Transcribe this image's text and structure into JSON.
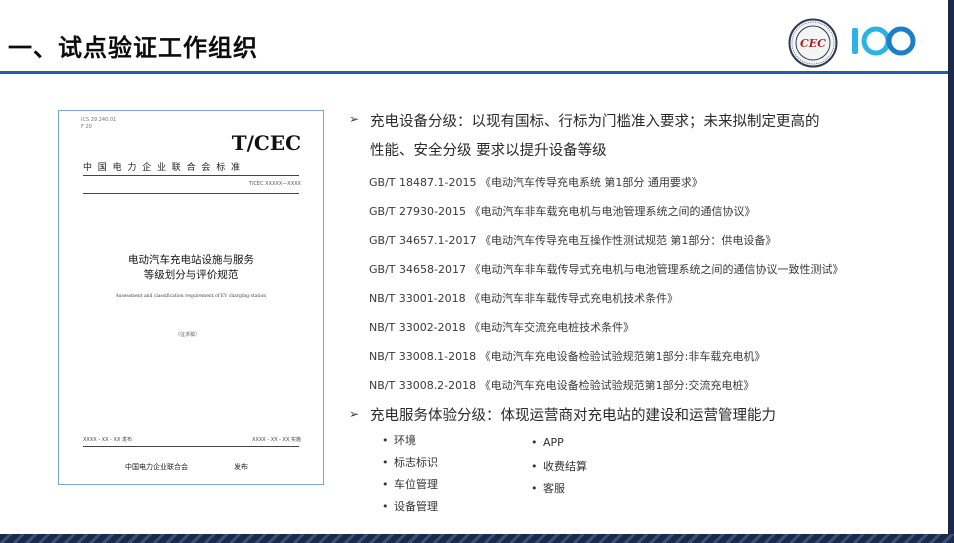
{
  "slide": {
    "title": "一、试点验证工作组织",
    "colors": {
      "rule": "#1f5fa8",
      "frame": "#1c2a4a",
      "doc_border": "#7da6d8"
    },
    "logos": [
      {
        "name": "cec-seal",
        "letters": "CEC"
      },
      {
        "name": "centenary-100",
        "text": "100"
      }
    ]
  },
  "document": {
    "meta_line1": "ICS 29.240.01",
    "meta_line2": "F 20",
    "brand": "T/CEC",
    "standard_name": "中国电力企业联合会标准",
    "number": "T/CEC XXXXX—XXXX",
    "title_line1": "电动汽车充电站设施与服务",
    "title_line2": "等级划分与评价规范",
    "english_title": "Assessment and classification requirement of EV charging station",
    "draft_label": "（征求稿）",
    "issue_date": "XXXX - XX - XX 发布",
    "impl_date": "XXXX - XX - XX 实施",
    "publisher": "中国电力企业联合会",
    "publisher_suffix": "发布"
  },
  "content": {
    "arrow_icon": "➢",
    "section1": {
      "line1": "充电设备分级：以现有国标、行标为门槛准入要求；未来拟制定更高的",
      "line2": "性能、安全分级 要求以提升设备等级"
    },
    "standards": [
      "GB/T 18487.1-2015 《电动汽车传导充电系统 第1部分 通用要求》",
      "GB/T 27930-2015 《电动汽车非车载充电机与电池管理系统之间的通信协议》",
      "GB/T 34657.1-2017 《电动汽车传导充电互操作性测试规范 第1部分：供电设备》",
      "GB/T 34658-2017 《电动汽车非车载传导式充电机与电池管理系统之间的通信协议一致性测试》",
      "NB/T 33001-2018 《电动汽车非车载传导式充电机技术条件》",
      "NB/T 33002-2018 《电动汽车交流充电桩技术条件》",
      "NB/T 33008.1-2018 《电动汽车充电设备检验试验规范第1部分:非车载充电机》",
      "NB/T 33008.2-2018 《电动汽车充电设备检验试验规范第1部分:交流充电桩》"
    ],
    "section2": "充电服务体验分级：体现运营商对充电站的建设和运营管理能力",
    "services_left": [
      "环境",
      "标志标识",
      "车位管理",
      "设备管理"
    ],
    "services_right": [
      "APP",
      "收费结算",
      "客服"
    ]
  }
}
